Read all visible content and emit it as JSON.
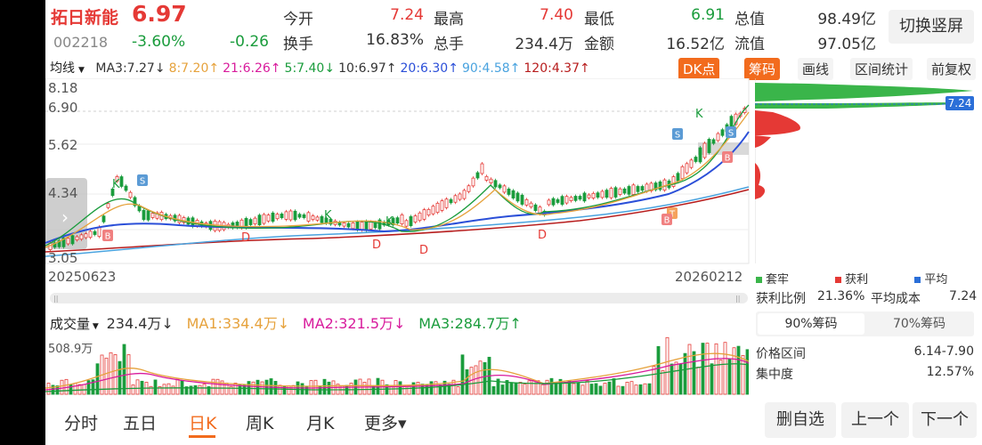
{
  "stock": {
    "name": "拓日新能",
    "price": "6.97",
    "code": "002218",
    "change_pct": "-3.60%",
    "change": "-0.26"
  },
  "quote": {
    "open_label": "今开",
    "open": "7.24",
    "high_label": "最高",
    "high": "7.40",
    "low_label": "最低",
    "low": "6.91",
    "mktcap_label": "总值",
    "mktcap": "98.49亿",
    "turnover_label": "换手",
    "turnover": "16.83%",
    "volume_label": "总手",
    "volume": "234.4万",
    "amount_label": "金额",
    "amount": "16.52亿",
    "float_label": "流值",
    "float": "97.05亿"
  },
  "toggle_screen_label": "切换竖屏",
  "ma_bar": {
    "selector": "均线",
    "items": [
      {
        "text": "MA3:7.27↓",
        "color": "#333333"
      },
      {
        "text": "8:7.20↑",
        "color": "#e6a23c"
      },
      {
        "text": "21:6.26↑",
        "color": "#d81b9c"
      },
      {
        "text": "5:7.40↓",
        "color": "#1a9c3c"
      },
      {
        "text": "10:6.97↑",
        "color": "#333333"
      },
      {
        "text": "20:6.30↑",
        "color": "#2b4fd8"
      },
      {
        "text": "90:4.58↑",
        "color": "#4aa3df"
      },
      {
        "text": "120:4.37↑",
        "color": "#b71c1c"
      }
    ]
  },
  "tools": {
    "dk": "DK点",
    "chips": "筹码",
    "draw": "画线",
    "range_stats": "区间统计",
    "adjust": "前复权"
  },
  "price_axis": [
    "8.18",
    "6.90",
    "5.62",
    "4.34",
    "3.05"
  ],
  "date_start": "20250623",
  "date_end": "20260212",
  "chip_panel": {
    "current_price_tag": "7.24",
    "legend": [
      {
        "label": "套牢",
        "color": "#3ab54a"
      },
      {
        "label": "获利",
        "color": "#e53935"
      },
      {
        "label": "平均",
        "color": "#2b6fd8"
      }
    ],
    "profit_ratio_label": "获利比例",
    "profit_ratio": "21.36%",
    "avg_cost_label": "平均成本",
    "avg_cost": "7.24",
    "tab_90": "90%筹码",
    "tab_70": "70%筹码",
    "price_range_label": "价格区间",
    "price_range": "6.14-7.90",
    "concentration_label": "集中度",
    "concentration": "12.57%"
  },
  "volume_bar": {
    "selector": "成交量",
    "value": "234.4万↓",
    "ma1": "MA1:334.4万↓",
    "ma2": "MA2:321.5万↓",
    "ma3": "MA3:284.7万↑",
    "axis_max": "508.9万"
  },
  "signals": {
    "buy": "B",
    "sell": "S",
    "k": "K",
    "d": "D",
    "t": "T"
  },
  "bottom_tabs": [
    "分时",
    "五日",
    "日K",
    "周K",
    "月K",
    "更多"
  ],
  "actions": {
    "remove_watch": "删自选",
    "prev": "上一个",
    "next": "下一个"
  },
  "colors": {
    "up": "#e53935",
    "down": "#1a9c3c",
    "accent": "#f26b1d"
  }
}
